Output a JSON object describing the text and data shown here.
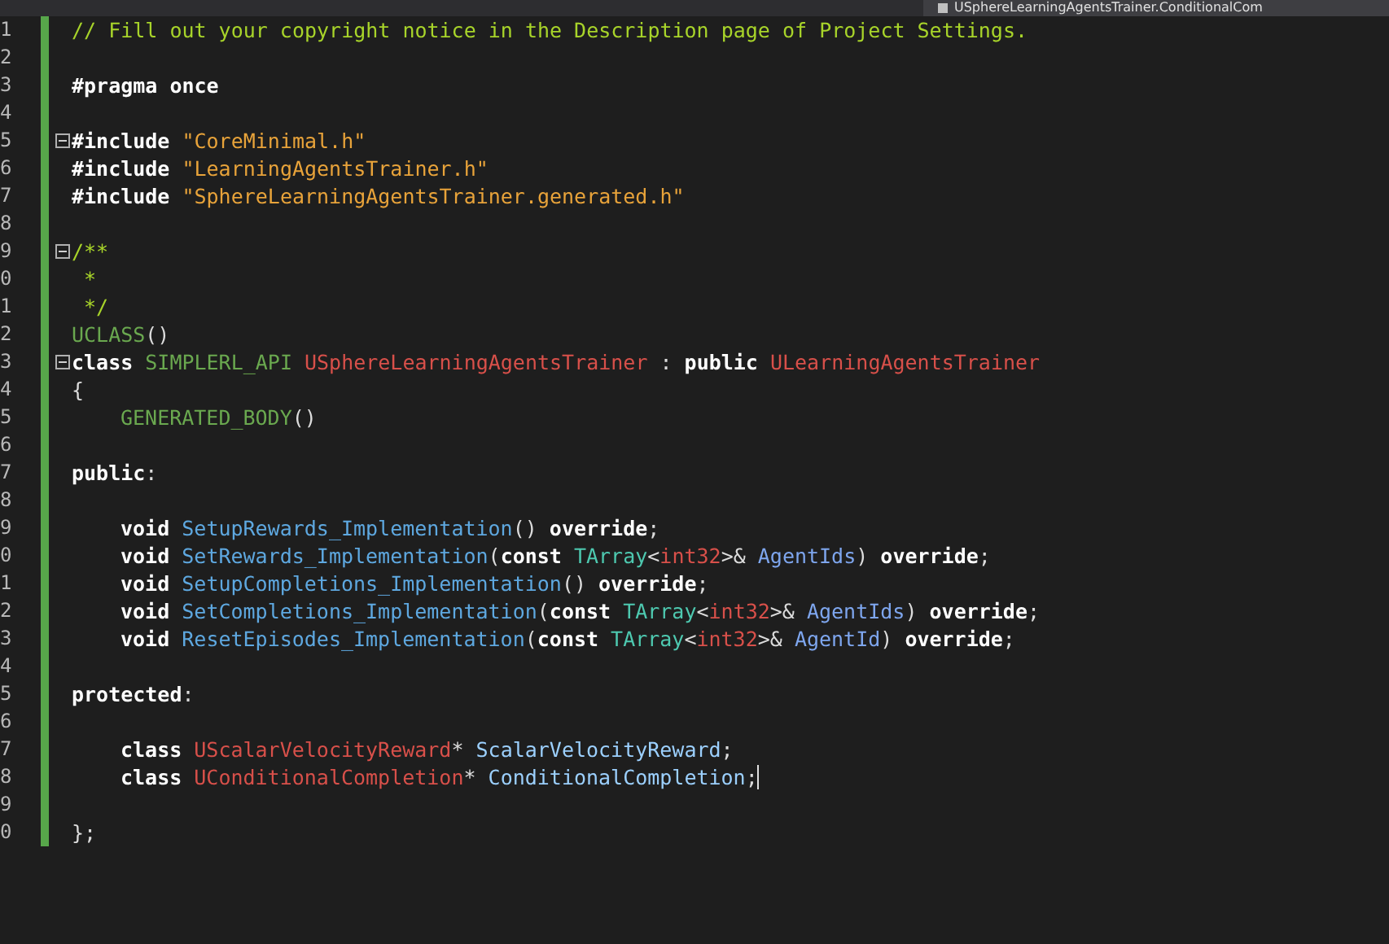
{
  "tab": {
    "title": "USphereLearningAgentsTrainer.ConditionalCom"
  },
  "lines": [
    {
      "number": "1",
      "fold": false,
      "caret": false,
      "indented": false,
      "tokens": [
        {
          "text": "// Fill out your copyright notice in the Description page of Project Settings.",
          "kind": "comment"
        }
      ]
    },
    {
      "number": "2",
      "fold": false,
      "caret": false
    },
    {
      "number": "3",
      "fold": false,
      "caret": false,
      "indented": false,
      "tokens": [
        {
          "text": "#pragma once",
          "kind": "keyword"
        }
      ]
    },
    {
      "number": "4",
      "fold": false,
      "caret": false
    },
    {
      "number": "5",
      "fold": true,
      "caret": false,
      "indented": false,
      "tokens": [
        {
          "text": "#include ",
          "kind": "keyword"
        },
        {
          "text": "\"CoreMinimal.h\"",
          "kind": "string"
        }
      ]
    },
    {
      "number": "6",
      "fold": false,
      "caret": false,
      "indented": false,
      "tokens": [
        {
          "text": "#include ",
          "kind": "keyword"
        },
        {
          "text": "\"LearningAgentsTrainer.h\"",
          "kind": "string"
        }
      ]
    },
    {
      "number": "7",
      "fold": false,
      "caret": false,
      "indented": false,
      "tokens": [
        {
          "text": "#include ",
          "kind": "keyword"
        },
        {
          "text": "\"SphereLearningAgentsTrainer.generated.h\"",
          "kind": "string"
        }
      ]
    },
    {
      "number": "8",
      "fold": false,
      "caret": false
    },
    {
      "number": "9",
      "fold": true,
      "caret": false,
      "indented": false,
      "tokens": [
        {
          "text": "/**",
          "kind": "comment"
        }
      ]
    },
    {
      "number": "0",
      "fold": false,
      "caret": false,
      "indented": false,
      "tokens": [
        {
          "text": " *",
          "kind": "comment"
        }
      ]
    },
    {
      "number": "1",
      "fold": false,
      "caret": false,
      "indented": false,
      "tokens": [
        {
          "text": " */",
          "kind": "comment"
        }
      ]
    },
    {
      "number": "2",
      "fold": false,
      "caret": false,
      "indented": false,
      "tokens": [
        {
          "text": "UCLASS",
          "kind": "macro"
        },
        {
          "text": "()",
          "kind": "punct"
        }
      ]
    },
    {
      "number": "3",
      "fold": true,
      "caret": false,
      "indented": false,
      "tokens": [
        {
          "text": "class ",
          "kind": "keyword"
        },
        {
          "text": "SIMPLERL_API ",
          "kind": "macro"
        },
        {
          "text": "USphereLearningAgentsTrainer",
          "kind": "class"
        },
        {
          "text": " : ",
          "kind": "punct"
        },
        {
          "text": "public ",
          "kind": "keyword"
        },
        {
          "text": "ULearningAgentsTrainer",
          "kind": "class"
        }
      ]
    },
    {
      "number": "4",
      "fold": false,
      "caret": false,
      "indented": false,
      "tokens": [
        {
          "text": "{",
          "kind": "punct"
        }
      ]
    },
    {
      "number": "5",
      "fold": false,
      "caret": false,
      "indented": true,
      "tokens": [
        {
          "text": "GENERATED_BODY",
          "kind": "macro"
        },
        {
          "text": "()",
          "kind": "punct"
        }
      ]
    },
    {
      "number": "6",
      "fold": false,
      "caret": false
    },
    {
      "number": "7",
      "fold": false,
      "caret": false,
      "indented": false,
      "tokens": [
        {
          "text": "public",
          "kind": "keyword"
        },
        {
          "text": ":",
          "kind": "punct"
        }
      ]
    },
    {
      "number": "8",
      "fold": false,
      "caret": false
    },
    {
      "number": "9",
      "fold": false,
      "caret": false,
      "indented": true,
      "tokens": [
        {
          "text": "void ",
          "kind": "keyword"
        },
        {
          "text": "SetupRewards_Implementation",
          "kind": "function"
        },
        {
          "text": "() ",
          "kind": "punct"
        },
        {
          "text": "override",
          "kind": "keyword"
        },
        {
          "text": ";",
          "kind": "punct"
        }
      ]
    },
    {
      "number": "0",
      "fold": false,
      "caret": false,
      "indented": true,
      "tokens": [
        {
          "text": "void ",
          "kind": "keyword"
        },
        {
          "text": "SetRewards_Implementation",
          "kind": "function"
        },
        {
          "text": "(",
          "kind": "punct"
        },
        {
          "text": "const ",
          "kind": "keyword"
        },
        {
          "text": "TArray",
          "kind": "template"
        },
        {
          "text": "<",
          "kind": "punct"
        },
        {
          "text": "int32",
          "kind": "class"
        },
        {
          "text": ">& ",
          "kind": "punct"
        },
        {
          "text": "AgentIds",
          "kind": "param"
        },
        {
          "text": ") ",
          "kind": "punct"
        },
        {
          "text": "override",
          "kind": "keyword"
        },
        {
          "text": ";",
          "kind": "punct"
        }
      ]
    },
    {
      "number": "1",
      "fold": false,
      "caret": false,
      "indented": true,
      "tokens": [
        {
          "text": "void ",
          "kind": "keyword"
        },
        {
          "text": "SetupCompletions_Implementation",
          "kind": "function"
        },
        {
          "text": "() ",
          "kind": "punct"
        },
        {
          "text": "override",
          "kind": "keyword"
        },
        {
          "text": ";",
          "kind": "punct"
        }
      ]
    },
    {
      "number": "2",
      "fold": false,
      "caret": false,
      "indented": true,
      "tokens": [
        {
          "text": "void ",
          "kind": "keyword"
        },
        {
          "text": "SetCompletions_Implementation",
          "kind": "function"
        },
        {
          "text": "(",
          "kind": "punct"
        },
        {
          "text": "const ",
          "kind": "keyword"
        },
        {
          "text": "TArray",
          "kind": "template"
        },
        {
          "text": "<",
          "kind": "punct"
        },
        {
          "text": "int32",
          "kind": "class"
        },
        {
          "text": ">& ",
          "kind": "punct"
        },
        {
          "text": "AgentIds",
          "kind": "param"
        },
        {
          "text": ") ",
          "kind": "punct"
        },
        {
          "text": "override",
          "kind": "keyword"
        },
        {
          "text": ";",
          "kind": "punct"
        }
      ]
    },
    {
      "number": "3",
      "fold": false,
      "caret": false,
      "indented": true,
      "tokens": [
        {
          "text": "void ",
          "kind": "keyword"
        },
        {
          "text": "ResetEpisodes_Implementation",
          "kind": "function"
        },
        {
          "text": "(",
          "kind": "punct"
        },
        {
          "text": "const ",
          "kind": "keyword"
        },
        {
          "text": "TArray",
          "kind": "template"
        },
        {
          "text": "<",
          "kind": "punct"
        },
        {
          "text": "int32",
          "kind": "class"
        },
        {
          "text": ">& ",
          "kind": "punct"
        },
        {
          "text": "AgentId",
          "kind": "param"
        },
        {
          "text": ") ",
          "kind": "punct"
        },
        {
          "text": "override",
          "kind": "keyword"
        },
        {
          "text": ";",
          "kind": "punct"
        }
      ]
    },
    {
      "number": "4",
      "fold": false,
      "caret": false
    },
    {
      "number": "5",
      "fold": false,
      "caret": false,
      "indented": false,
      "tokens": [
        {
          "text": "protected",
          "kind": "keyword"
        },
        {
          "text": ":",
          "kind": "punct"
        }
      ]
    },
    {
      "number": "6",
      "fold": false,
      "caret": false
    },
    {
      "number": "7",
      "fold": false,
      "caret": false,
      "indented": true,
      "tokens": [
        {
          "text": "class ",
          "kind": "keyword"
        },
        {
          "text": "UScalarVelocityReward",
          "kind": "class"
        },
        {
          "text": "* ",
          "kind": "punct"
        },
        {
          "text": "ScalarVelocityReward",
          "kind": "member"
        },
        {
          "text": ";",
          "kind": "punct"
        }
      ]
    },
    {
      "number": "8",
      "fold": false,
      "caret": true,
      "indented": true,
      "tokens": [
        {
          "text": "class ",
          "kind": "keyword"
        },
        {
          "text": "UConditionalCompletion",
          "kind": "class"
        },
        {
          "text": "* ",
          "kind": "punct"
        },
        {
          "text": "ConditionalCompletion",
          "kind": "member"
        },
        {
          "text": ";",
          "kind": "punct"
        }
      ]
    },
    {
      "number": "9",
      "fold": false,
      "caret": false
    },
    {
      "number": "0",
      "fold": false,
      "caret": false,
      "indented": false,
      "tokens": [
        {
          "text": "};",
          "kind": "punct"
        }
      ]
    }
  ]
}
